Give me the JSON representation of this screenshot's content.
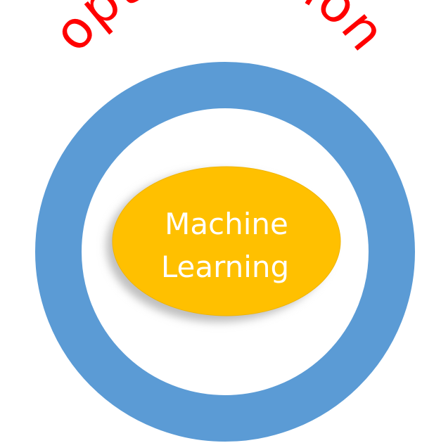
{
  "outer_label": "optimization",
  "inner_label": {
    "line1": "Machine",
    "line2": "Learning"
  },
  "colors": {
    "outer_ring": "#5b9bd5",
    "outer_ring_stroke": "#4a86c2",
    "inner_ellipse": "#ffc000",
    "inner_ellipse_stroke": "#f0b400",
    "inner_text": "#ffffff",
    "outer_text": "#ff0000",
    "shadow": "#bfbfbf"
  }
}
